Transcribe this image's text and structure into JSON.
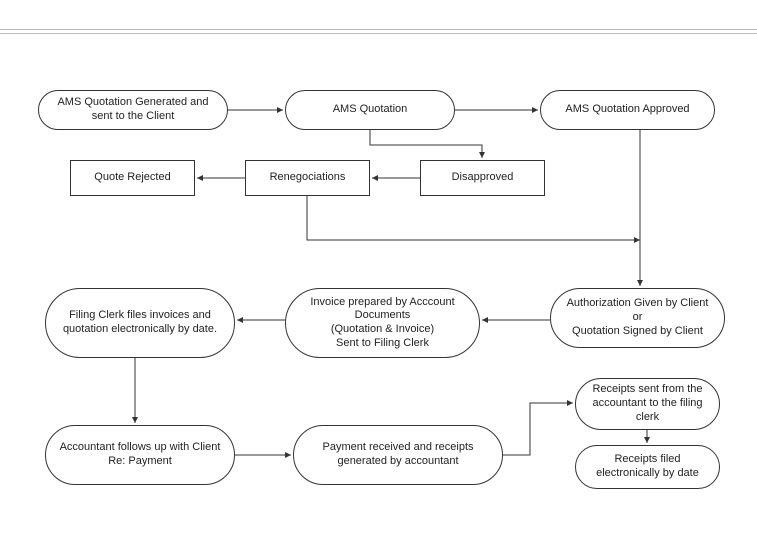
{
  "nodes": {
    "n1": "AMS Quotation Generated and sent to the Client",
    "n2": "AMS Quotation",
    "n3": "AMS Quotation Approved",
    "n4": "Quote Rejected",
    "n5": "Renegociations",
    "n6": "Disapproved",
    "n7": "Authorization Given by Client\nor\nQuotation Signed by Client",
    "n8": "Invoice prepared by Acccount Documents\n(Quotation & Invoice)\nSent to Filing Clerk",
    "n9": "Filing Clerk files invoices and quotation electronically by date.",
    "n10": "Accountant follows up with Client Re: Payment",
    "n11": "Payment received and receipts generated by accountant",
    "n12": "Receipts sent from the accountant to the filing clerk",
    "n13": "Receipts filed electronically by date"
  }
}
